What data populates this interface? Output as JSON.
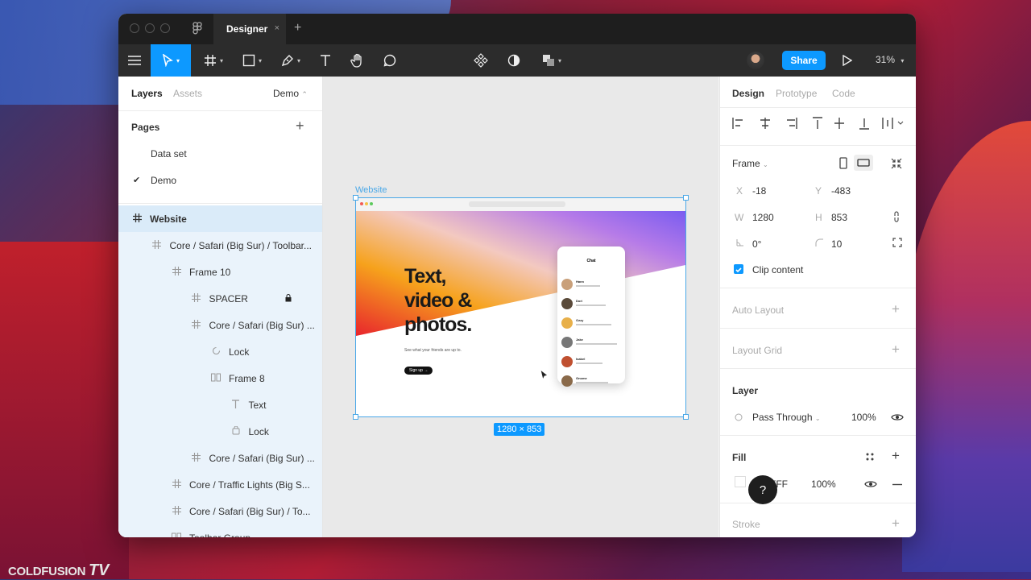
{
  "app": {
    "tab_title": "Designer",
    "tab_close": "×",
    "tab_add": "+"
  },
  "toolbar": {
    "share_label": "Share",
    "zoom_label": "31%"
  },
  "left_panel": {
    "tabs": [
      "Layers",
      "Assets"
    ],
    "page_selector": "Demo",
    "pages_title": "Pages",
    "pages_add": "+",
    "pages": [
      {
        "label": "Data set",
        "checked": false
      },
      {
        "label": "Demo",
        "checked": true
      }
    ],
    "layers": [
      {
        "label": "Website",
        "icon": "frame-icon",
        "indent": 0,
        "selected": true
      },
      {
        "label": "Core / Safari (Big Sur) / Toolbar...",
        "icon": "frame-icon",
        "indent": 1
      },
      {
        "label": "Frame 10",
        "icon": "frame-icon",
        "indent": 2
      },
      {
        "label": "SPACER",
        "icon": "frame-icon",
        "indent": 3,
        "locked": true
      },
      {
        "label": "Core / Safari (Big Sur) ...",
        "icon": "frame-icon",
        "indent": 3
      },
      {
        "label": "Lock",
        "icon": "component-icon",
        "indent": 4
      },
      {
        "label": "Frame 8",
        "icon": "columns-icon",
        "indent": 4
      },
      {
        "label": "Text",
        "icon": "text-icon",
        "indent": 5
      },
      {
        "label": "Lock",
        "icon": "image-icon",
        "indent": 5
      },
      {
        "label": "Core / Safari (Big Sur) ...",
        "icon": "frame-icon",
        "indent": 3
      },
      {
        "label": "Core / Traffic Lights (Big S...",
        "icon": "frame-icon",
        "indent": 2
      },
      {
        "label": "Core / Safari (Big Sur) / To...",
        "icon": "frame-icon",
        "indent": 2
      },
      {
        "label": "Toolbar Group",
        "icon": "columns-icon",
        "indent": 2
      }
    ]
  },
  "canvas": {
    "frame_label": "Website",
    "dimension_badge": "1280 × 853",
    "hero_text": [
      "Text,",
      "video &",
      "photos."
    ],
    "hero_subtext": "See what your friends are up to.",
    "hero_button": "Sign up →",
    "chat_title": "Chat",
    "chat_names": [
      "Hann",
      "Dori",
      "Ozzy",
      "Jake",
      "Isabel",
      "Gnome"
    ]
  },
  "right_panel": {
    "tabs": [
      "Design",
      "Prototype",
      "Code"
    ],
    "frame_label": "Frame",
    "x_label": "X",
    "x_value": "-18",
    "y_label": "Y",
    "y_value": "-483",
    "w_label": "W",
    "w_value": "1280",
    "h_label": "H",
    "h_value": "853",
    "rotation_value": "0°",
    "radius_value": "10",
    "clip_content": "Clip content",
    "auto_layout": "Auto Layout",
    "layout_grid": "Layout Grid",
    "layer_title": "Layer",
    "blend_mode": "Pass Through",
    "layer_opacity": "100%",
    "fill_title": "Fill",
    "fill_hex": "FFFFFF",
    "fill_opacity": "100%",
    "stroke_title": "Stroke"
  },
  "help_label": "?",
  "watermark": {
    "text": "COLDFUSION",
    "suffix": "TV"
  },
  "colors": {
    "accent": "#0d99ff",
    "dark_toolbar": "#2c2c2c",
    "selection": "#4aa8e8"
  }
}
